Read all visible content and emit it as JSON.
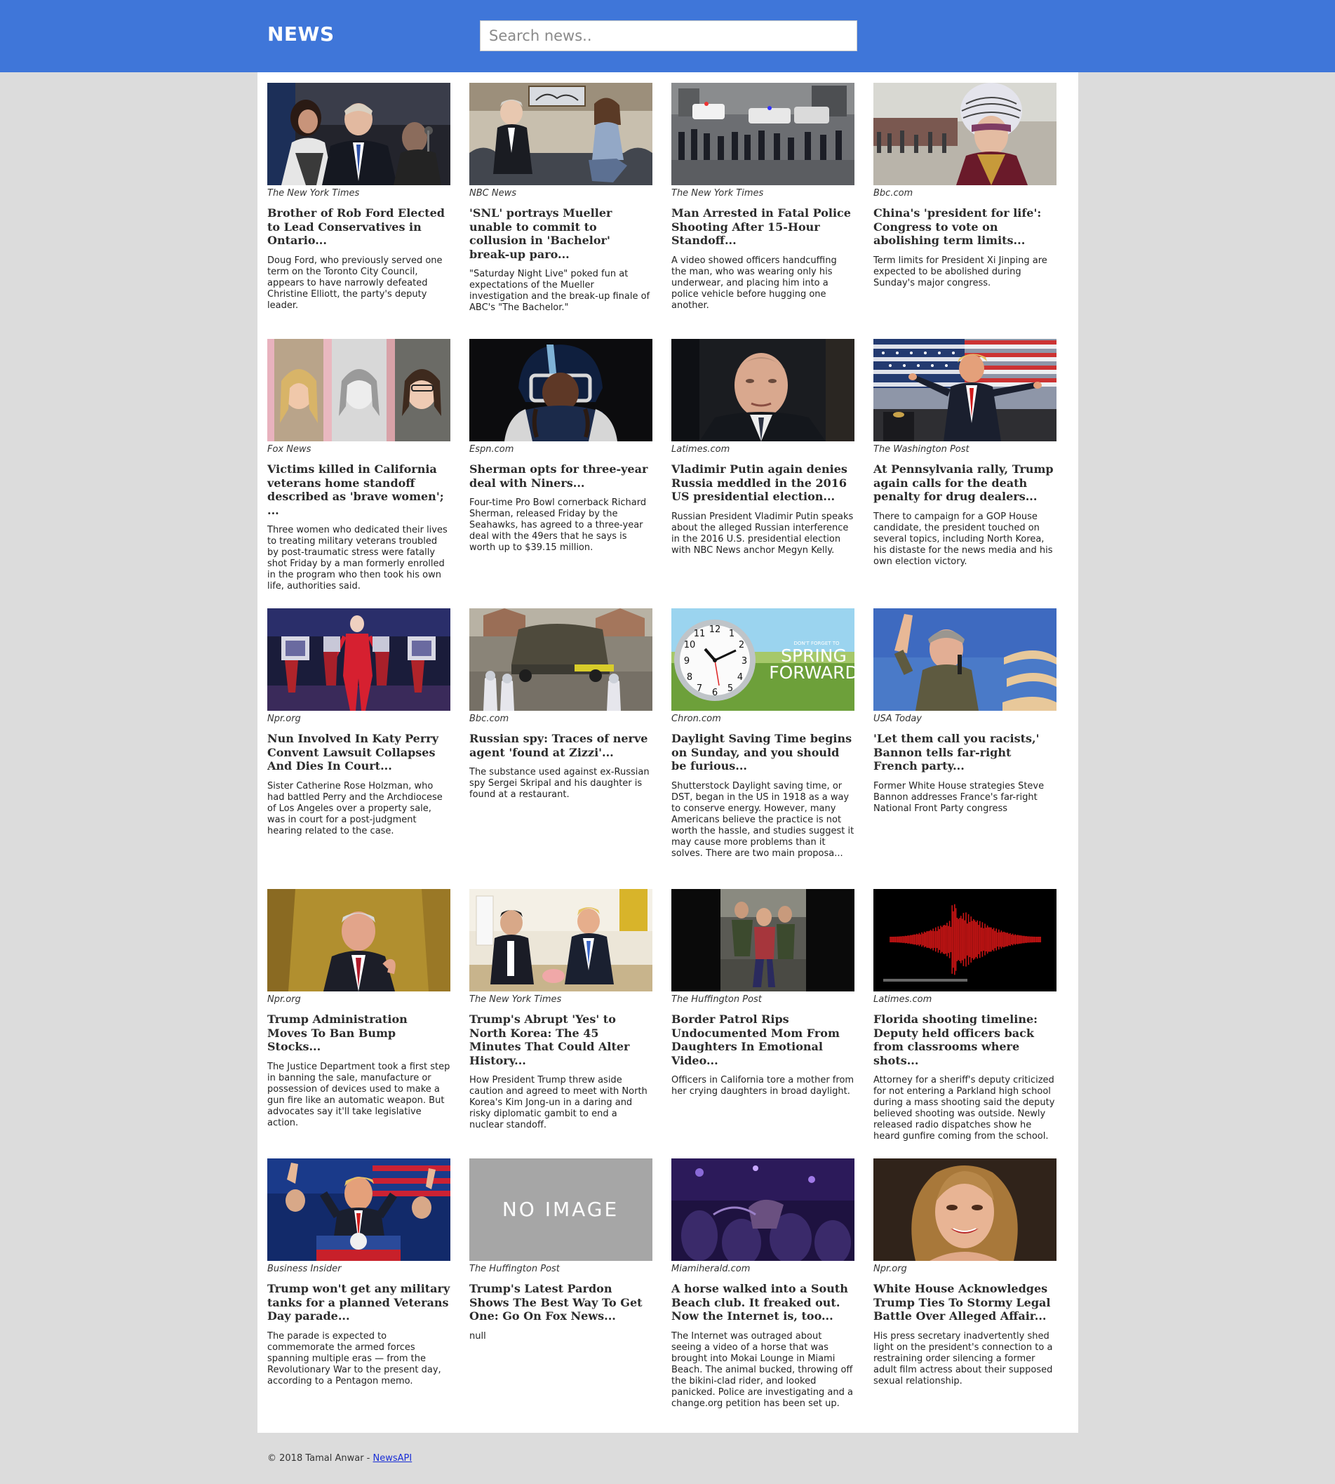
{
  "header": {
    "brand": "NEWS",
    "search_placeholder": "Search news.."
  },
  "articles": [
    {
      "source": "The New York Times",
      "title": "Brother of Rob Ford Elected to Lead Conservatives in Ontario...",
      "description": "Doug Ford, who previously served one term on the Toronto City Council, appears to have narrowly defeated Christine Elliott, the party's deputy leader."
    },
    {
      "source": "NBC News",
      "title": "'SNL' portrays Mueller unable to commit to collusion in 'Bachelor' break-up paro...",
      "description": "\"Saturday Night Live\" poked fun at expectations of the Mueller investigation and the break-up finale of ABC's \"The Bachelor.\""
    },
    {
      "source": "The New York Times",
      "title": "Man Arrested in Fatal Police Shooting After 15-Hour Standoff...",
      "description": "A video showed officers handcuffing the man, who was wearing only his underwear, and placing him into a police vehicle before hugging one another."
    },
    {
      "source": "Bbc.com",
      "title": "China's 'president for life': Congress to vote on abolishing term limits...",
      "description": "Term limits for President Xi Jinping are expected to be abolished during Sunday's major congress."
    },
    {
      "source": "Fox News",
      "title": "Victims killed in California veterans home standoff described as 'brave women'; ...",
      "description": "Three women who dedicated their lives to treating military veterans troubled by post-traumatic stress were fatally shot Friday by a man formerly enrolled in the program who then took his own life, authorities said."
    },
    {
      "source": "Espn.com",
      "title": "Sherman opts for three-year deal with Niners...",
      "description": "Four-time Pro Bowl cornerback Richard Sherman, released Friday by the Seahawks, has agreed to a three-year deal with the 49ers that he says is worth up to $39.15 million."
    },
    {
      "source": "Latimes.com",
      "title": "Vladimir Putin again denies Russia meddled in the 2016 US presidential election...",
      "description": "Russian President Vladimir Putin speaks about the alleged Russian interference in the 2016 U.S. presidential election with NBC News anchor Megyn Kelly."
    },
    {
      "source": "The Washington Post",
      "title": "At Pennsylvania rally, Trump again calls for the death penalty for drug dealers...",
      "description": "There to campaign for a GOP House candidate, the president touched on several topics, including North Korea, his distaste for the news media and his own election victory."
    },
    {
      "source": "Npr.org",
      "title": "Nun Involved In Katy Perry Convent Lawsuit Collapses And Dies In Court...",
      "description": "Sister Catherine Rose Holzman, who had battled Perry and the Archdiocese of Los Angeles over a property sale, was in court for a post-judgment hearing related to the case."
    },
    {
      "source": "Bbc.com",
      "title": "Russian spy: Traces of nerve agent 'found at Zizzi'...",
      "description": "The substance used against ex-Russian spy Sergei Skripal and his daughter is found at a restaurant."
    },
    {
      "source": "Chron.com",
      "title": "Daylight Saving Time begins on Sunday, and you should be furious...",
      "description": "Shutterstock Daylight saving time, or DST, began in the US in 1918 as a way to conserve energy. However, many Americans believe the practice is not worth the hassle, and studies suggest it may cause more problems than it solves. There are two main proposa..."
    },
    {
      "source": "USA Today",
      "title": "'Let them call you racists,' Bannon tells far-right French party...",
      "description": "Former White House strategies Steve Bannon addresses France's far-right National Front Party congress"
    },
    {
      "source": "Npr.org",
      "title": "Trump Administration Moves To Ban Bump Stocks...",
      "description": "The Justice Department took a first step in banning the sale, manufacture or possession of devices used to make a gun fire like an automatic weapon. But advocates say it'll take legislative action."
    },
    {
      "source": "The New York Times",
      "title": "Trump's Abrupt 'Yes' to North Korea: The 45 Minutes That Could Alter History...",
      "description": "How President Trump threw aside caution and agreed to meet with North Korea's Kim Jong-un in a daring and risky diplomatic gambit to end a nuclear standoff."
    },
    {
      "source": "The Huffington Post",
      "title": "Border Patrol Rips Undocumented Mom From Daughters In Emotional Video...",
      "description": "Officers in California tore a mother from her crying daughters in broad daylight."
    },
    {
      "source": "Latimes.com",
      "title": "Florida shooting timeline: Deputy held officers back from classrooms where shots...",
      "description": "Attorney for a sheriff's deputy criticized for not entering a Parkland high school during a mass shooting said the deputy believed shooting was outside. Newly released radio dispatches show he heard gunfire coming from the school."
    },
    {
      "source": "Business Insider",
      "title": "Trump won't get any military tanks for a planned Veterans Day parade...",
      "description": "The parade is expected to commemorate the armed forces spanning multiple eras — from the Revolutionary War to the present day, according to a Pentagon memo."
    },
    {
      "source": "The Huffington Post",
      "title": "Trump's Latest Pardon Shows The Best Way To Get One: Go On Fox News...",
      "description": "null"
    },
    {
      "source": "Miamiherald.com",
      "title": "A horse walked into a South Beach club. It freaked out. Now the Internet is, too...",
      "description": "The Internet was outraged about seeing a video of a horse that was brought into Mokai Lounge in Miami Beach. The animal bucked, throwing off the bikini-clad rider, and looked panicked. Police are investigating and a change.org petition has been set up."
    },
    {
      "source": "Npr.org",
      "title": "White House Acknowledges Trump Ties To Stormy Legal Battle Over Alleged Affair...",
      "description": "His press secretary inadvertently shed light on the president's connection to a restraining order silencing a former adult film actress about their supposed sexual relationship."
    }
  ],
  "thumbnails": {
    "no_image_text": "NO IMAGE",
    "clock_banner": {
      "small": "DON'T FORGET TO",
      "line1": "SPRING",
      "line2": "FORWARD"
    }
  },
  "footer": {
    "copyright": "© 2018 Tamal Anwar -",
    "link": "NewsAPI"
  }
}
